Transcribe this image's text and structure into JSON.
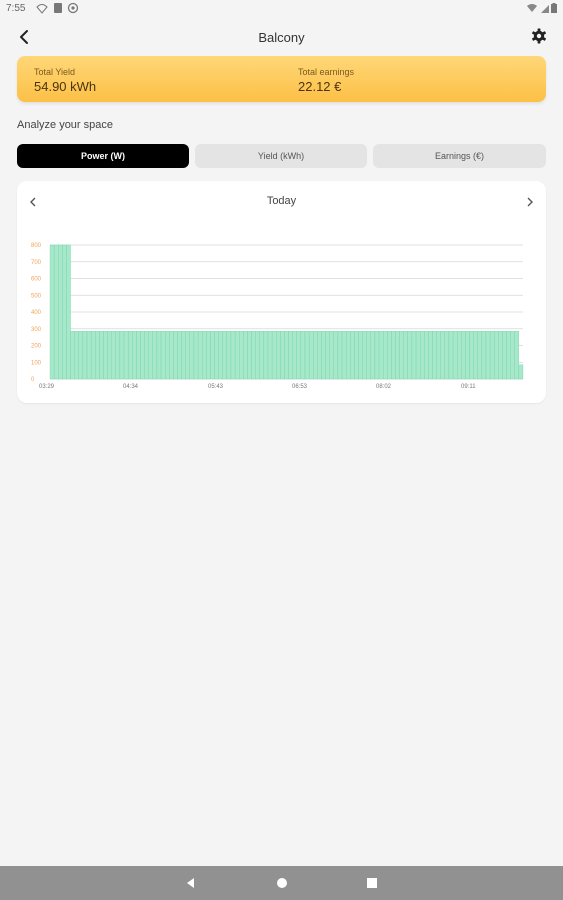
{
  "status": {
    "time": "7:55"
  },
  "header": {
    "title": "Balcony"
  },
  "summary": {
    "yield_label": "Total Yield",
    "yield_value": "54.90 kWh",
    "earnings_label": "Total earnings",
    "earnings_value": "22.12 €"
  },
  "section_label": "Analyze your space",
  "tabs": [
    {
      "label": "Power (W)",
      "active": true
    },
    {
      "label": "Yield (kWh)",
      "active": false
    },
    {
      "label": "Earnings (€)",
      "active": false
    }
  ],
  "period": "Today",
  "colors": {
    "accent": "#fcc046",
    "bar_fill": "#a6e8c9",
    "bar_stroke": "#62cfa0",
    "tick_y": "#f2a35a"
  },
  "chart_data": {
    "type": "bar",
    "title": "",
    "xlabel": "",
    "ylabel": "",
    "ylim": [
      0,
      800
    ],
    "yticks": [
      0,
      100,
      200,
      300,
      400,
      500,
      600,
      700,
      800
    ],
    "xtick_labels": [
      "03:29",
      "04:34",
      "05:43",
      "06:53",
      "08:02",
      "09:11"
    ],
    "values": [
      800,
      800,
      800,
      800,
      800,
      285,
      285,
      285,
      285,
      285,
      285,
      285,
      285,
      285,
      285,
      285,
      285,
      285,
      285,
      285,
      285,
      285,
      285,
      285,
      285,
      285,
      285,
      285,
      285,
      285,
      285,
      285,
      285,
      285,
      285,
      285,
      285,
      285,
      285,
      285,
      285,
      285,
      285,
      285,
      285,
      285,
      285,
      285,
      285,
      285,
      285,
      285,
      285,
      285,
      285,
      285,
      285,
      285,
      285,
      285,
      285,
      285,
      285,
      285,
      285,
      285,
      285,
      285,
      285,
      285,
      285,
      285,
      285,
      285,
      285,
      285,
      285,
      285,
      285,
      285,
      285,
      285,
      285,
      285,
      285,
      285,
      285,
      285,
      285,
      285,
      285,
      285,
      285,
      285,
      285,
      285,
      285,
      285,
      285,
      285,
      285,
      285,
      285,
      285,
      285,
      285,
      285,
      285,
      285,
      285,
      285,
      285,
      285,
      285,
      85
    ],
    "grid": true,
    "legend": "none"
  }
}
